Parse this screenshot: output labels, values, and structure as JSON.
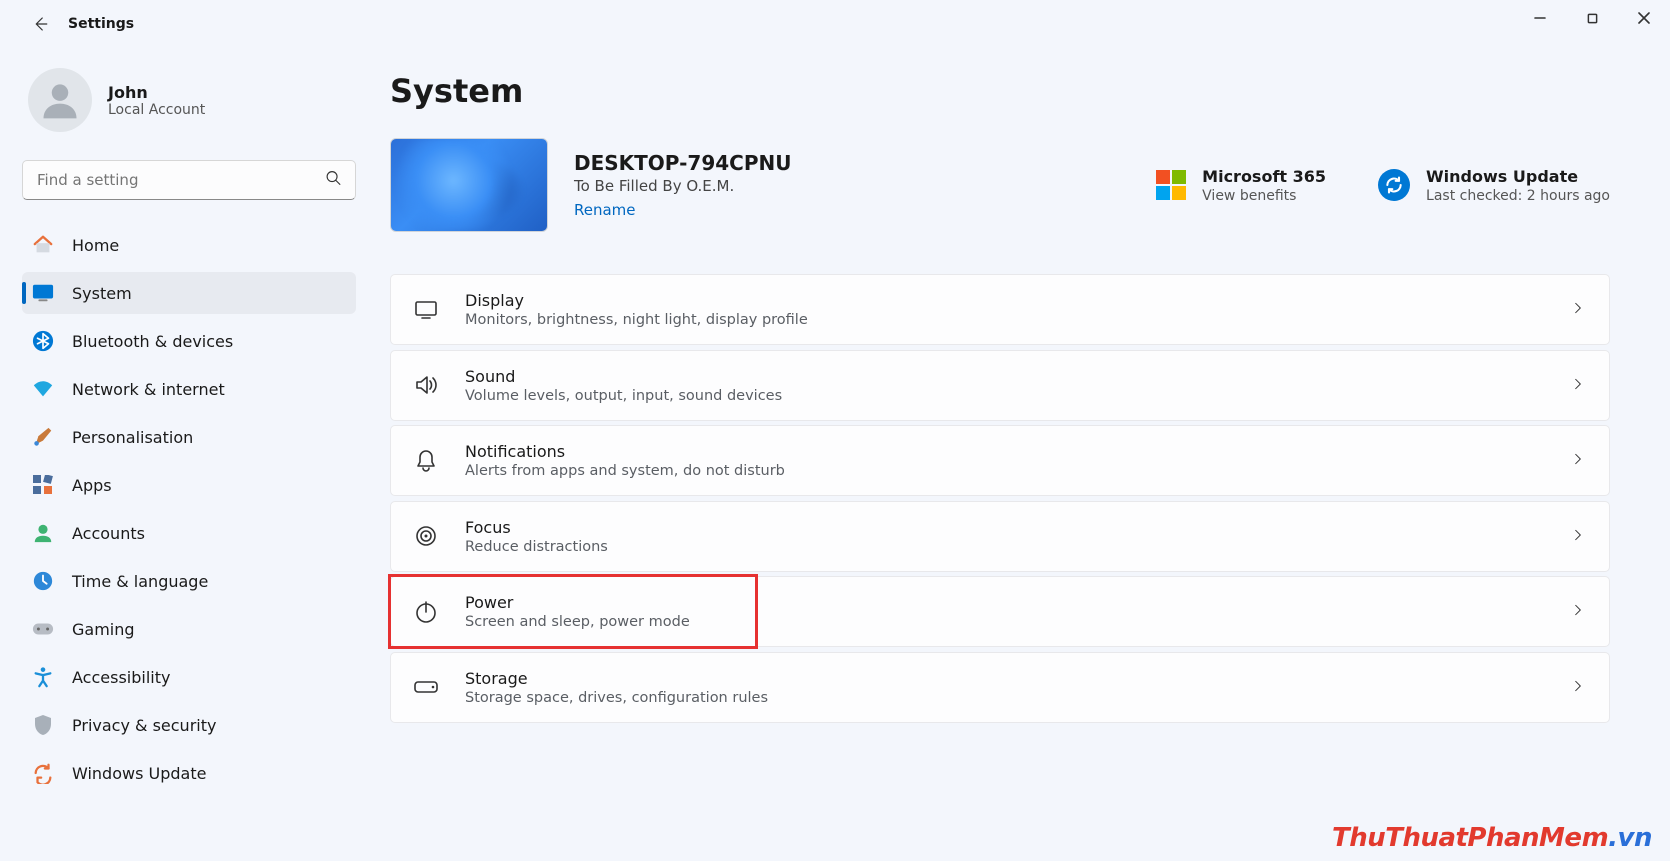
{
  "window": {
    "title": "Settings"
  },
  "account": {
    "name": "John",
    "sub": "Local Account"
  },
  "search": {
    "placeholder": "Find a setting"
  },
  "nav": [
    {
      "key": "home",
      "label": "Home"
    },
    {
      "key": "system",
      "label": "System"
    },
    {
      "key": "bluetooth",
      "label": "Bluetooth & devices"
    },
    {
      "key": "network",
      "label": "Network & internet"
    },
    {
      "key": "personalisation",
      "label": "Personalisation"
    },
    {
      "key": "apps",
      "label": "Apps"
    },
    {
      "key": "accounts",
      "label": "Accounts"
    },
    {
      "key": "time",
      "label": "Time & language"
    },
    {
      "key": "gaming",
      "label": "Gaming"
    },
    {
      "key": "accessibility",
      "label": "Accessibility"
    },
    {
      "key": "privacy",
      "label": "Privacy & security"
    },
    {
      "key": "update",
      "label": "Windows Update"
    }
  ],
  "page": {
    "title": "System"
  },
  "device": {
    "name": "DESKTOP-794CPNU",
    "oem": "To Be Filled By O.E.M.",
    "rename": "Rename"
  },
  "ms365": {
    "title": "Microsoft 365",
    "sub": "View benefits"
  },
  "winupdate": {
    "title": "Windows Update",
    "sub": "Last checked: 2 hours ago"
  },
  "cards": [
    {
      "key": "display",
      "title": "Display",
      "sub": "Monitors, brightness, night light, display profile"
    },
    {
      "key": "sound",
      "title": "Sound",
      "sub": "Volume levels, output, input, sound devices"
    },
    {
      "key": "notifications",
      "title": "Notifications",
      "sub": "Alerts from apps and system, do not disturb"
    },
    {
      "key": "focus",
      "title": "Focus",
      "sub": "Reduce distractions"
    },
    {
      "key": "power",
      "title": "Power",
      "sub": "Screen and sleep, power mode"
    },
    {
      "key": "storage",
      "title": "Storage",
      "sub": "Storage space, drives, configuration rules"
    }
  ],
  "watermark": {
    "a": "ThuThuatPhanMem",
    "b": ".vn"
  }
}
